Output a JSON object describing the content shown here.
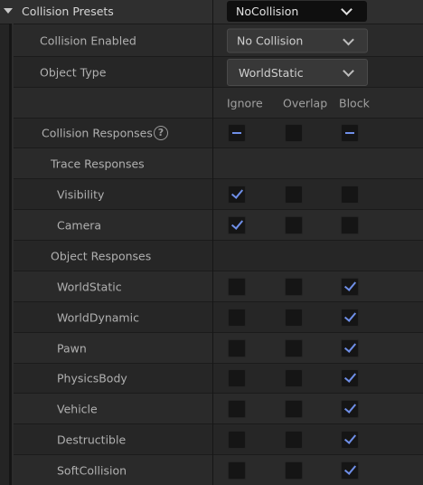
{
  "header": {
    "title": "Collision Presets",
    "preset_value": "NoCollision"
  },
  "collision_enabled": {
    "label": "Collision Enabled",
    "value": "No Collision"
  },
  "object_type": {
    "label": "Object Type",
    "value": "WorldStatic"
  },
  "columns": {
    "ignore": "Ignore",
    "overlap": "Overlap",
    "block": "Block"
  },
  "collision_responses": {
    "label": "Collision Responses",
    "help": "?",
    "state": [
      "mixed",
      "none",
      "mixed"
    ]
  },
  "trace_responses": {
    "label": "Trace Responses",
    "items": [
      {
        "label": "Visibility",
        "state": [
          true,
          false,
          false
        ]
      },
      {
        "label": "Camera",
        "state": [
          true,
          false,
          false
        ]
      }
    ]
  },
  "object_responses": {
    "label": "Object Responses",
    "items": [
      {
        "label": "WorldStatic",
        "state": [
          false,
          false,
          true
        ]
      },
      {
        "label": "WorldDynamic",
        "state": [
          false,
          false,
          true
        ]
      },
      {
        "label": "Pawn",
        "state": [
          false,
          false,
          true
        ]
      },
      {
        "label": "PhysicsBody",
        "state": [
          false,
          false,
          true
        ]
      },
      {
        "label": "Vehicle",
        "state": [
          false,
          false,
          true
        ]
      },
      {
        "label": "Destructible",
        "state": [
          false,
          false,
          true
        ]
      },
      {
        "label": "SoftCollision",
        "state": [
          false,
          false,
          true
        ]
      }
    ]
  }
}
